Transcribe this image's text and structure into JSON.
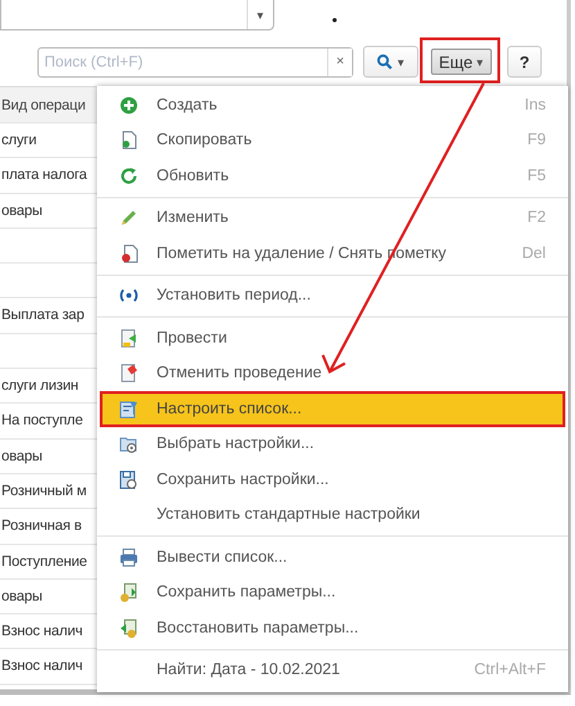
{
  "combo_field": {
    "caret": "▾"
  },
  "toolbar": {
    "search": {
      "placeholder": "Поиск (Ctrl+F)",
      "clear": "×"
    },
    "search_button": {
      "caret": "▾"
    },
    "more_button": {
      "label": "Еще",
      "caret": "▾",
      "highlighted": true
    },
    "help_button": {
      "label": "?"
    }
  },
  "table": {
    "header": "Вид операци",
    "rows": [
      {
        "kind": "text",
        "text": "слуги"
      },
      {
        "kind": "text",
        "text": "плата налога"
      },
      {
        "kind": "text",
        "text": "овары"
      },
      {
        "kind": "blank"
      },
      {
        "kind": "blank"
      },
      {
        "kind": "text",
        "text": "Выплата зар"
      },
      {
        "kind": "blank"
      },
      {
        "kind": "text",
        "text": "слуги лизин"
      },
      {
        "kind": "text",
        "text": "На поступле"
      },
      {
        "kind": "text",
        "text": "овары"
      },
      {
        "kind": "text",
        "text": "Розничный м"
      },
      {
        "kind": "text",
        "text": "Розничная в"
      },
      {
        "kind": "text",
        "text": "Поступление"
      },
      {
        "kind": "text",
        "text": "овары"
      },
      {
        "kind": "text",
        "text": "Взнос налич"
      },
      {
        "kind": "text",
        "text": "Взнос налич"
      }
    ]
  },
  "menu": {
    "items": [
      {
        "kind": "item",
        "label": "Создать",
        "shortcut": "Ins",
        "selected": false
      },
      {
        "kind": "item",
        "label": "Скопировать",
        "shortcut": "F9",
        "selected": false
      },
      {
        "kind": "item",
        "label": "Обновить",
        "shortcut": "F5",
        "selected": false
      },
      {
        "kind": "divider"
      },
      {
        "kind": "item",
        "label": "Изменить",
        "shortcut": "F2",
        "selected": false
      },
      {
        "kind": "item",
        "label": "Пометить на удаление / Снять пометку",
        "shortcut": "Del",
        "selected": false
      },
      {
        "kind": "divider"
      },
      {
        "kind": "item",
        "label": "Установить период...",
        "selected": false
      },
      {
        "kind": "divider"
      },
      {
        "kind": "item",
        "label": "Провести",
        "selected": false
      },
      {
        "kind": "item",
        "label": "Отменить проведение",
        "selected": false
      },
      {
        "kind": "item",
        "label": "Настроить список...",
        "selected": true
      },
      {
        "kind": "item",
        "label": "Выбрать настройки...",
        "selected": false
      },
      {
        "kind": "item",
        "label": "Сохранить настройки...",
        "selected": false
      },
      {
        "kind": "item",
        "label": "Установить стандартные настройки",
        "selected": false
      },
      {
        "kind": "divider"
      },
      {
        "kind": "item",
        "label": "Вывести список...",
        "selected": false
      },
      {
        "kind": "item",
        "label": "Сохранить параметры...",
        "selected": false
      },
      {
        "kind": "item",
        "label": "Восстановить параметры...",
        "selected": false
      },
      {
        "kind": "divider"
      },
      {
        "kind": "item",
        "label": "Найти: Дата - 10.02.2021",
        "shortcut": "Ctrl+Alt+F",
        "selected": false
      }
    ]
  }
}
